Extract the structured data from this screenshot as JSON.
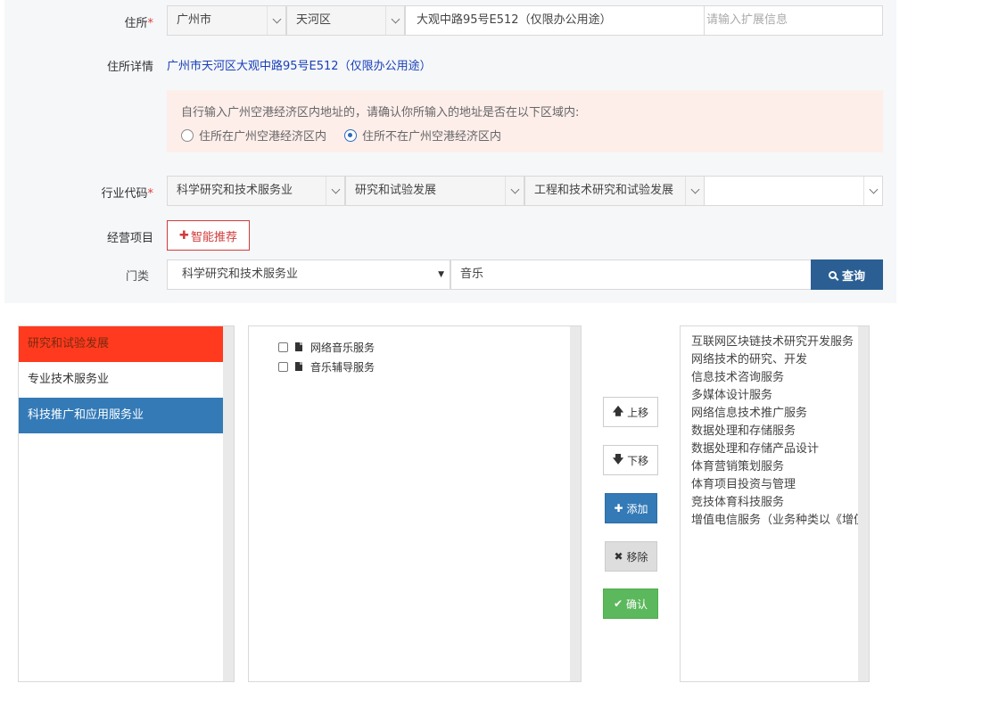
{
  "address": {
    "label": "住所",
    "required_mark": "*",
    "city": "广州市",
    "district": "天河区",
    "street": "大观中路95号E512（仅限办公用途）",
    "ext_placeholder": "请输入扩展信息"
  },
  "address_detail": {
    "label": "住所详情",
    "value": "广州市天河区大观中路95号E512（仅限办公用途）"
  },
  "notice": {
    "text": "自行输入广州空港经济区内地址的，请确认你所输入的地址是否在以下区域内:",
    "options": [
      "住所在广州空港经济区内",
      "住所不在广州空港经济区内"
    ],
    "selected_index": 1
  },
  "industry": {
    "label": "行业代码",
    "required_mark": "*",
    "level1": "科学研究和技术服务业",
    "level2": "研究和试验发展",
    "level3": "工程和技术研究和试验发展",
    "level4": ""
  },
  "business_scope": {
    "label": "经营项目",
    "smart_button": "智能推荐"
  },
  "category_search": {
    "label": "门类",
    "category": "科学研究和技术服务业",
    "keyword": "音乐",
    "search_button": "查询"
  },
  "category_list": {
    "items": [
      "研究和试验发展",
      "专业技术服务业",
      "科技推广和应用服务业"
    ]
  },
  "results": {
    "items": [
      "网络音乐服务",
      "音乐辅导服务"
    ]
  },
  "actions": {
    "up": "上移",
    "down": "下移",
    "add": "添加",
    "remove": "移除",
    "confirm": "确认"
  },
  "selected": {
    "items": [
      "互联网区块链技术研究开发服务",
      "网络技术的研究、开发",
      "信息技术咨询服务",
      "多媒体设计服务",
      "网络信息技术推广服务",
      "数据处理和存储服务",
      "数据处理和存储产品设计",
      "体育营销策划服务",
      "体育项目投资与管理",
      "竞技体育科技服务",
      "增值电信服务（业务种类以《增值电信业务经营许可证》载明内容为准）"
    ]
  },
  "colors": {
    "accent_red": "#d23b3b",
    "active_red": "#ff3a1e",
    "active_blue": "#337ab7",
    "search_blue": "#2b5f94",
    "confirm_green": "#5cb85c",
    "detail_link": "#1a3fb8"
  }
}
